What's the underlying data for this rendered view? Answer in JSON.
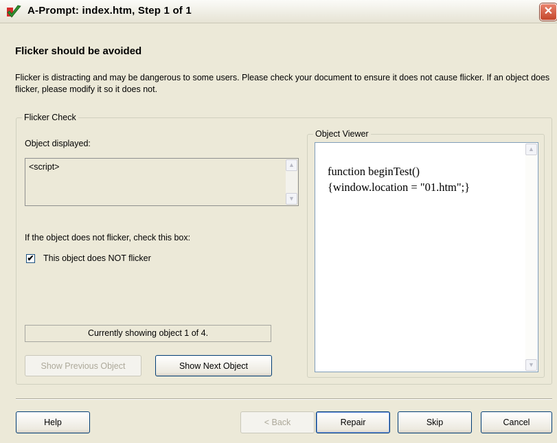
{
  "window": {
    "title": "A-Prompt: index.htm, Step 1 of 1",
    "close_glyph": "✕"
  },
  "heading": "Flicker should be avoided",
  "description": "Flicker is distracting and may be dangerous to some users. Please check your document to ensure it does not cause flicker. If an object does flicker, please modify it so it does not.",
  "flicker_check": {
    "legend": "Flicker Check",
    "object_displayed_label": "Object displayed:",
    "object_displayed_value": "<script>",
    "instruction": "If the object does not flicker, check this box:",
    "checkbox": {
      "label": "This object does NOT flicker",
      "checked": true,
      "glyph": "✔"
    },
    "status": "Currently showing object 1 of 4.",
    "prev_button": {
      "label": "Show Previous Object",
      "enabled": false
    },
    "next_button": {
      "label": "Show Next Object",
      "enabled": true
    }
  },
  "object_viewer": {
    "legend": "Object Viewer",
    "code_lines": [
      "function beginTest()",
      "{window.location = \"01.htm\";}"
    ]
  },
  "scroll_glyphs": {
    "up": "▲",
    "down": "▼"
  },
  "footer": {
    "help": "Help",
    "back": {
      "label": "< Back",
      "enabled": false
    },
    "repair": "Repair",
    "skip": "Skip",
    "cancel": "Cancel"
  },
  "colors": {
    "dialog_bg": "#ece9d8",
    "button_border": "#003c74",
    "close_red": "#c4462b"
  },
  "icons": [
    "app-checkmark-icon",
    "close-icon",
    "scroll-up-arrow-icon",
    "scroll-down-arrow-icon",
    "checkbox-check-icon"
  ]
}
